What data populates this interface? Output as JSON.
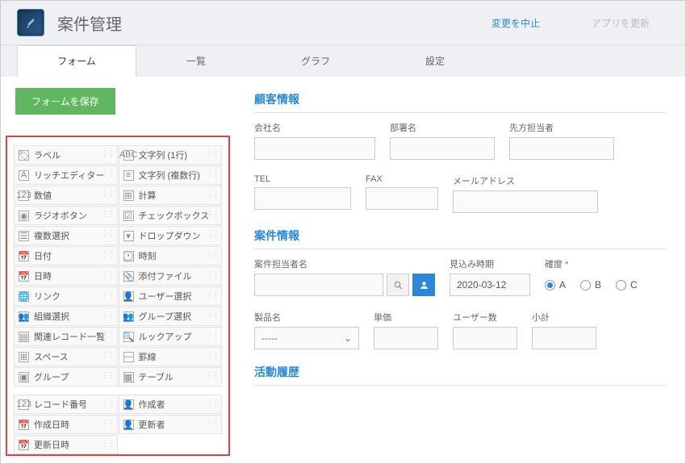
{
  "header": {
    "title": "案件管理",
    "cancel_label": "変更を中止",
    "update_label": "アプリを更新"
  },
  "tabs": {
    "items": [
      "フォーム",
      "一覧",
      "グラフ",
      "設定"
    ],
    "active_index": 0
  },
  "sidebar": {
    "save_label": "フォームを保存",
    "fields_left": [
      "ラベル",
      "リッチエディター",
      "数値",
      "ラジオボタン",
      "複数選択",
      "日付",
      "日時",
      "リンク",
      "組織選択",
      "関連レコード一覧",
      "スペース",
      "グループ"
    ],
    "fields_right": [
      "文字列 (1行)",
      "文字列 (複数行)",
      "計算",
      "チェックボックス",
      "ドロップダウン",
      "時刻",
      "添付ファイル",
      "ユーザー選択",
      "グループ選択",
      "ルックアップ",
      "罫線",
      "テーブル"
    ],
    "sys_left": [
      "レコード番号",
      "作成日時",
      "更新日時"
    ],
    "sys_right": [
      "作成者",
      "更新者"
    ]
  },
  "form": {
    "section1_title": "顧客情報",
    "company_label": "会社名",
    "department_label": "部署名",
    "contact_label": "先方担当者",
    "tel_label": "TEL",
    "fax_label": "FAX",
    "email_label": "メールアドレス",
    "section2_title": "案件情報",
    "assignee_label": "案件担当者名",
    "expected_label": "見込み時期",
    "expected_value": "2020-03-12",
    "probability_label": "確度",
    "radio_options": [
      "A",
      "B",
      "C"
    ],
    "radio_selected": 0,
    "product_label": "製品名",
    "product_placeholder": "-----",
    "unitprice_label": "単価",
    "users_label": "ユーザー数",
    "subtotal_label": "小計",
    "section3_title": "活動履歴"
  }
}
